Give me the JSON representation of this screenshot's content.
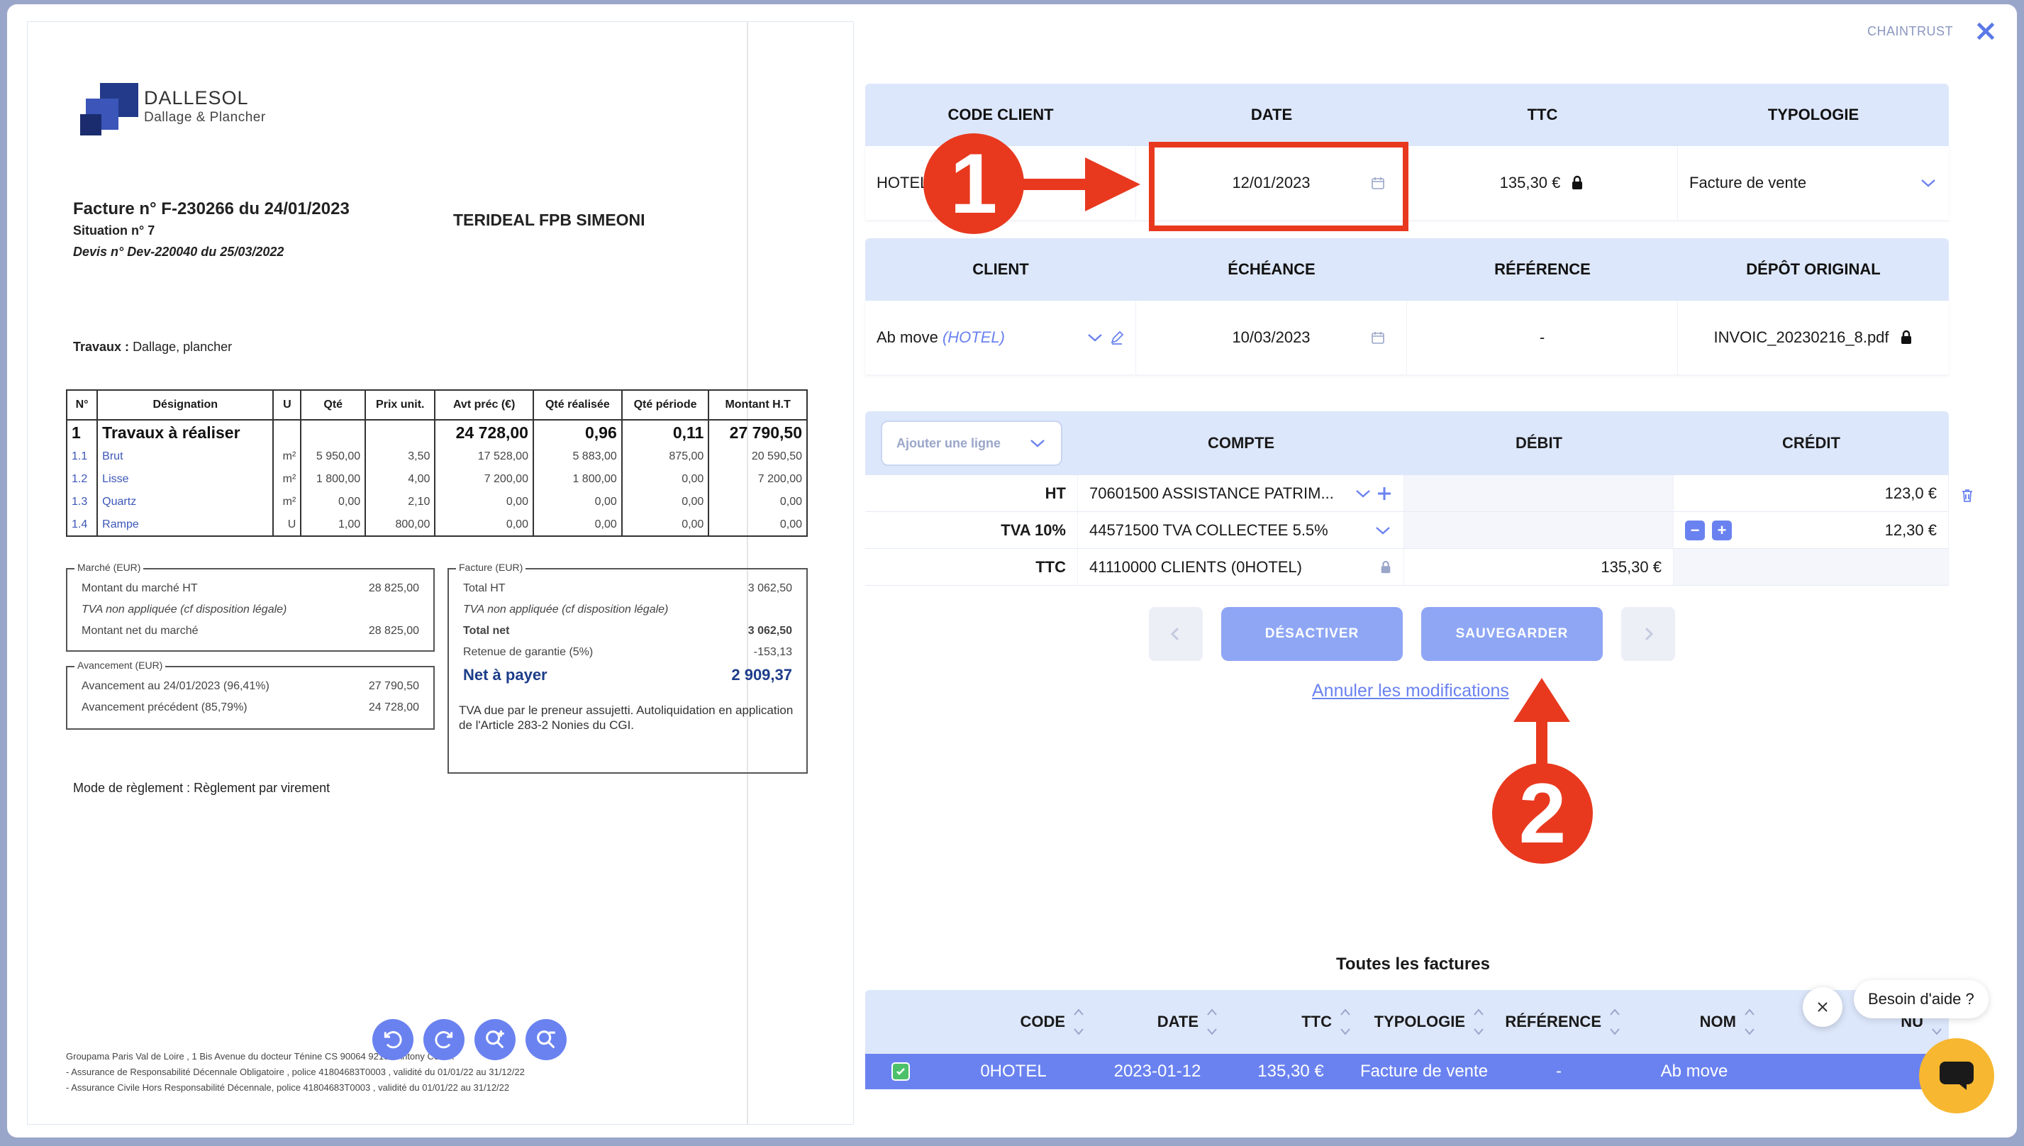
{
  "brand": "CHAINTRUST",
  "document": {
    "logo_name": "DALLESOL",
    "logo_sub": "Dallage & Plancher",
    "invoice_title": "Facture n° F-230266 du 24/01/2023",
    "situation": "Situation n° 7",
    "devis": "Devis n° Dev-220040 du 25/03/2022",
    "recipient": "TERIDEAL FPB SIMEONI",
    "travaux_label": "Travaux :",
    "travaux_value": "Dallage, plancher",
    "table_headers": [
      "N°",
      "Désignation",
      "U",
      "Qté",
      "Prix unit.",
      "Avt préc (€)",
      "Qté réalisée",
      "Qté période",
      "Montant H.T"
    ],
    "table_rows": [
      [
        "1",
        "Travaux à réaliser",
        "",
        "",
        "",
        "24 728,00",
        "0,96",
        "0,11",
        "27 790,50"
      ],
      [
        "1.1",
        "Brut",
        "m²",
        "5 950,00",
        "3,50",
        "17 528,00",
        "5 883,00",
        "875,00",
        "20 590,50"
      ],
      [
        "1.2",
        "Lisse",
        "m²",
        "1 800,00",
        "4,00",
        "7 200,00",
        "1 800,00",
        "0,00",
        "7 200,00"
      ],
      [
        "1.3",
        "Quartz",
        "m²",
        "0,00",
        "2,10",
        "0,00",
        "0,00",
        "0,00",
        "0,00"
      ],
      [
        "1.4",
        "Rampe",
        "U",
        "1,00",
        "800,00",
        "0,00",
        "0,00",
        "0,00",
        "0,00"
      ]
    ],
    "marche": {
      "header": "Marché (EUR)",
      "rows": [
        [
          "Montant du marché HT",
          "28 825,00"
        ],
        [
          "TVA non appliquée (cf disposition légale)",
          ""
        ],
        [
          "Montant net du marché",
          "28 825,00"
        ]
      ]
    },
    "avancement": {
      "header": "Avancement (EUR)",
      "rows": [
        [
          "Avancement au 24/01/2023 (96,41%)",
          "27 790,50"
        ],
        [
          "Avancement précédent (85,79%)",
          "24 728,00"
        ]
      ]
    },
    "facture": {
      "header": "Facture (EUR)",
      "rows": [
        [
          "Total HT",
          "3 062,50"
        ],
        [
          "TVA non appliquée (cf disposition légale)",
          ""
        ],
        [
          "Total net",
          "3 062,50"
        ],
        [
          "Retenue de garantie (5%)",
          "-153,13"
        ]
      ],
      "net_label": "Net à payer",
      "net_value": "2 909,37",
      "note": "TVA due par le preneur assujetti. Autoliquidation en application de l'Article 283-2 Nonies du CGI."
    },
    "reglement": "Mode de règlement : Règlement par virement",
    "footer_lines": [
      "Groupama Paris Val de Loire , 1 Bis Avenue du docteur Ténine CS 90064 92184 Antony Cedex",
      "- Assurance de Responsabilité Décennale Obligatoire , police 41804683T0003 , validité du 01/01/22 au 31/12/22",
      "- Assurance Civile Hors Responsabilité Décennale, police 41804683T0003 , validité du 01/01/22 au 31/12/22"
    ]
  },
  "header_table": {
    "headers": [
      "CODE CLIENT",
      "DATE",
      "TTC",
      "TYPOLOGIE"
    ],
    "code_client": "HOTEL",
    "date": "12/01/2023",
    "ttc": "135,30 €",
    "typologie": "Facture de vente"
  },
  "client_table": {
    "headers": [
      "CLIENT",
      "ÉCHÉANCE",
      "RÉFÉRENCE",
      "DÉPÔT ORIGINAL"
    ],
    "client_name": "Ab move",
    "client_code": "(HOTEL)",
    "echeance": "10/03/2023",
    "reference": "-",
    "depot": "INVOIC_20230216_8.pdf"
  },
  "ledger": {
    "add_line_placeholder": "Ajouter une ligne",
    "headers": [
      "COMPTE",
      "DÉBIT",
      "CRÉDIT"
    ],
    "rows": [
      {
        "label": "HT",
        "compte": "70601500 ASSISTANCE PATRIM...",
        "debit": "",
        "credit": "123,0 €"
      },
      {
        "label": "TVA 10%",
        "compte": "44571500 TVA COLLECTEE 5.5%",
        "debit": "",
        "credit": "12,30 €"
      },
      {
        "label": "TTC",
        "compte": "41110000 CLIENTS (0HOTEL)",
        "debit": "135,30 €",
        "credit": ""
      }
    ]
  },
  "actions": {
    "desactiver": "DÉSACTIVER",
    "sauvegarder": "SAUVEGARDER",
    "cancel": "Annuler les modifications"
  },
  "all_invoices": {
    "title": "Toutes les factures",
    "headers": [
      "CODE",
      "DATE",
      "TTC",
      "TYPOLOGIE",
      "RÉFÉRENCE",
      "NOM",
      "NU"
    ],
    "row": {
      "code": "0HOTEL",
      "date": "2023-01-12",
      "ttc": "135,30 €",
      "typologie": "Facture de vente",
      "reference": "-",
      "nom": "Ab move"
    }
  },
  "help": {
    "bubble": "Besoin d'aide ?"
  },
  "annotations": {
    "step1": "1",
    "step2": "2",
    "accent": "#e8391f"
  },
  "colors": {
    "primary": "#6a82f0",
    "header_bg": "#dde7fb",
    "annotation": "#e8391f"
  }
}
